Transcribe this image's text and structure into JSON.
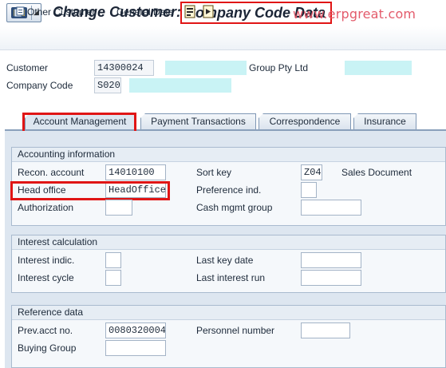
{
  "title": {
    "lead": "Change Customer:",
    "main": "Company Code Data"
  },
  "toolbar": {
    "other_customer": "Other Customer",
    "general_data": "General Data",
    "watermark": "www.erpgreat.com"
  },
  "header": {
    "customer_label": "Customer",
    "customer_value": "14300024",
    "customer_name_suffix": "Group Pty Ltd",
    "company_code_label": "Company Code",
    "company_code_value": "S020"
  },
  "tabs": [
    {
      "label": "Account Management",
      "active": true
    },
    {
      "label": "Payment Transactions",
      "active": false
    },
    {
      "label": "Correspondence",
      "active": false
    },
    {
      "label": "Insurance",
      "active": false
    }
  ],
  "groups": {
    "accounting": {
      "title": "Accounting information",
      "recon_label": "Recon. account",
      "recon_value": "14010100",
      "sortkey_label": "Sort key",
      "sortkey_value": "Z04",
      "sortkey_desc": "Sales Document",
      "headoffice_label": "Head office",
      "headoffice_value": "HeadOffice",
      "pref_label": "Preference ind.",
      "pref_value": "",
      "auth_label": "Authorization",
      "auth_value": "",
      "cash_label": "Cash mgmt group",
      "cash_value": ""
    },
    "interest": {
      "title": "Interest calculation",
      "indic_label": "Interest indic.",
      "indic_value": "",
      "lastkey_label": "Last key date",
      "lastkey_value": "",
      "cycle_label": "Interest cycle",
      "cycle_value": "",
      "lastrun_label": "Last interest run",
      "lastrun_value": ""
    },
    "reference": {
      "title": "Reference data",
      "prevacct_label": "Prev.acct no.",
      "prevacct_value": "0080320004",
      "personnel_label": "Personnel number",
      "personnel_value": "",
      "buying_label": "Buying Group",
      "buying_value": ""
    }
  },
  "colors": {
    "highlight": "#e01515",
    "watermark": "#e35b6b",
    "redaction": "#c9f3f5",
    "panel": "#dde6f0"
  },
  "icons": [
    "menu-icon",
    "other-customer-icon",
    "previous-page-icon",
    "next-page-icon"
  ]
}
